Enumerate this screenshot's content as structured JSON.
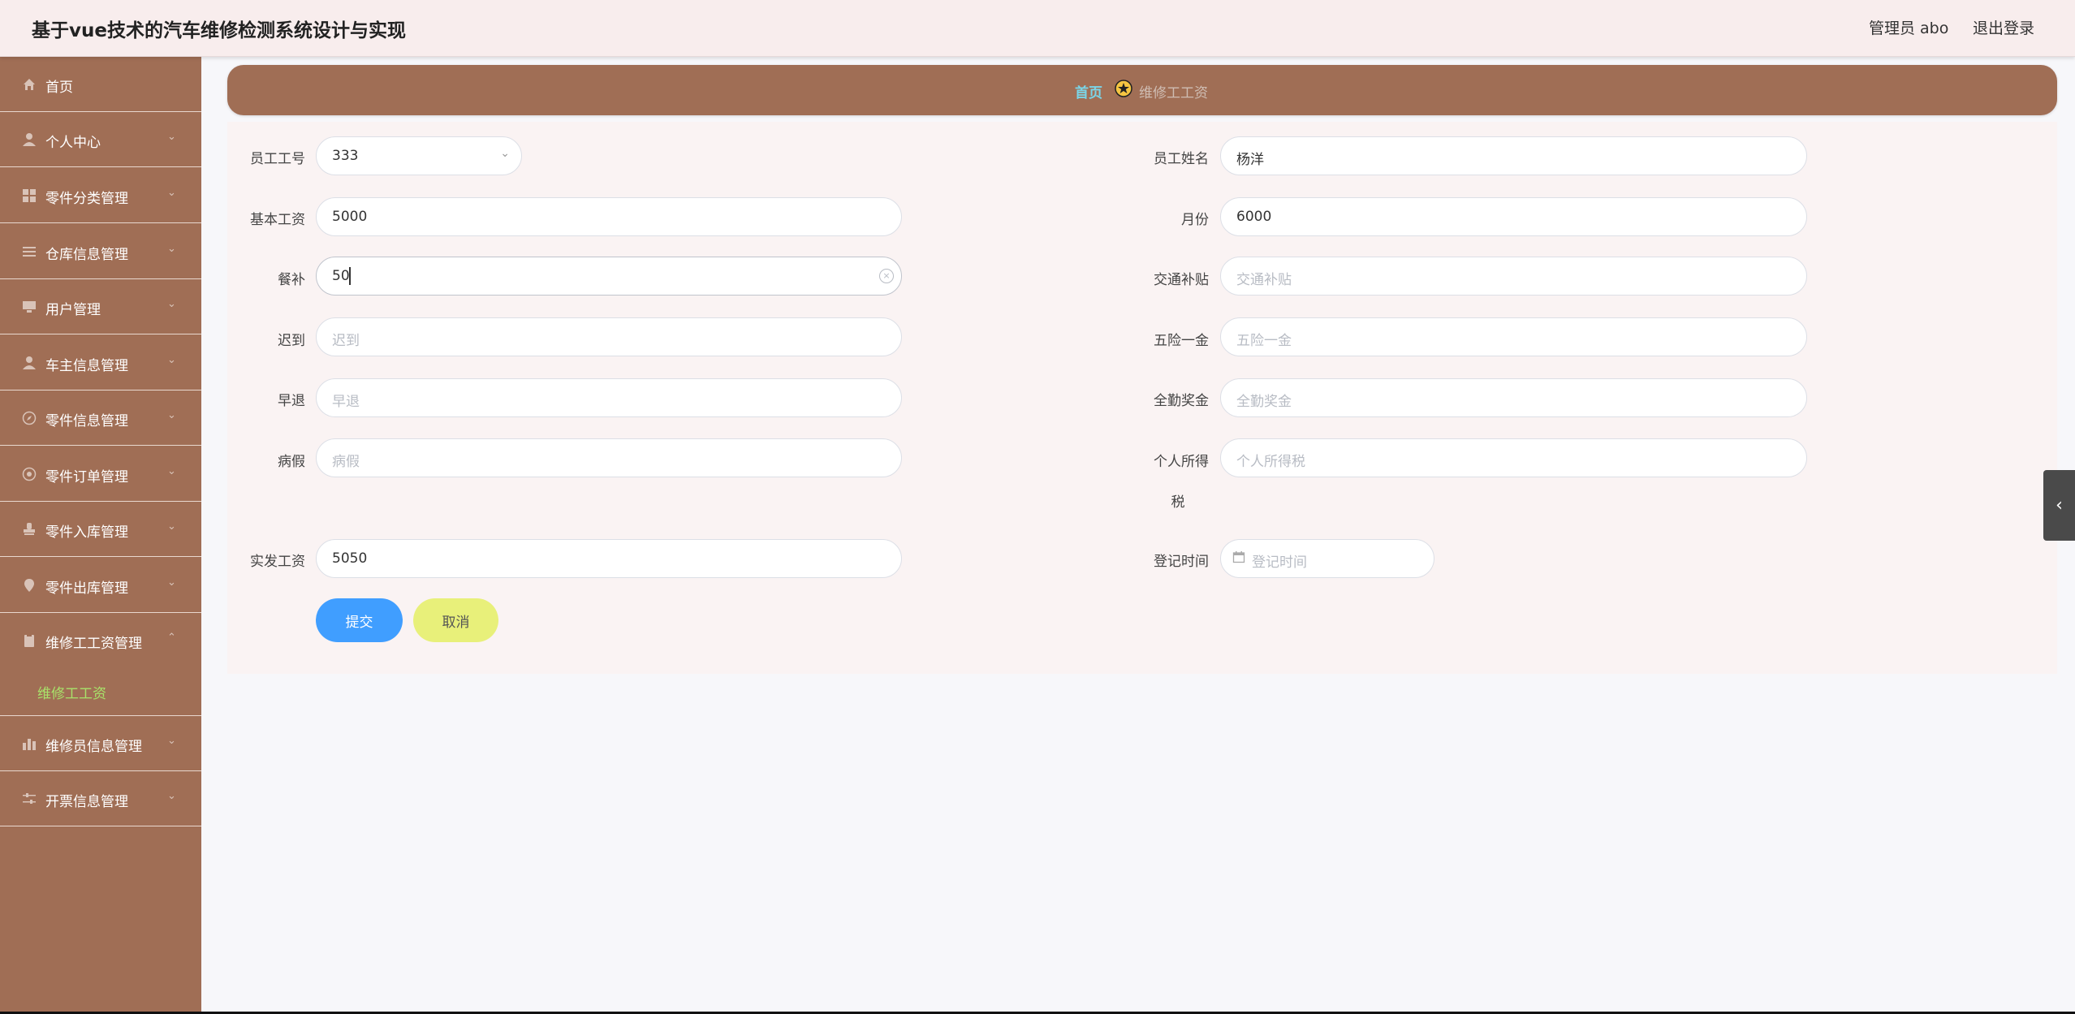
{
  "header": {
    "title": "基于vue技术的汽车维修检测系统设计与实现",
    "user": "管理员 abo",
    "logout": "退出登录"
  },
  "sidebar": {
    "items": [
      {
        "label": "首页",
        "icon": "home-icon"
      },
      {
        "label": "个人中心",
        "icon": "user-icon"
      },
      {
        "label": "零件分类管理",
        "icon": "grid-icon"
      },
      {
        "label": "仓库信息管理",
        "icon": "list-icon"
      },
      {
        "label": "用户管理",
        "icon": "monitor-icon"
      },
      {
        "label": "车主信息管理",
        "icon": "user-icon"
      },
      {
        "label": "零件信息管理",
        "icon": "compass-icon"
      },
      {
        "label": "零件订单管理",
        "icon": "settings-icon"
      },
      {
        "label": "零件入库管理",
        "icon": "stamp-icon"
      },
      {
        "label": "零件出库管理",
        "icon": "location-icon"
      },
      {
        "label": "维修工工资管理",
        "icon": "clipboard-icon"
      },
      {
        "label": "维修员信息管理",
        "icon": "chart-icon"
      },
      {
        "label": "开票信息管理",
        "icon": "sliders-icon"
      }
    ],
    "active_submenu": "维修工工资"
  },
  "breadcrumb": {
    "home": "首页",
    "current": "维修工工资"
  },
  "form": {
    "employee_no": {
      "label": "员工工号",
      "value": "333"
    },
    "employee_name": {
      "label": "员工姓名",
      "value": "杨洋"
    },
    "base_salary": {
      "label": "基本工资",
      "value": "5000"
    },
    "month": {
      "label": "月份",
      "value": "6000"
    },
    "meal_allowance": {
      "label": "餐补",
      "value": "50"
    },
    "transport_allowance": {
      "label": "交通补贴",
      "placeholder": "交通补贴"
    },
    "late": {
      "label": "迟到",
      "placeholder": "迟到"
    },
    "insurance": {
      "label": "五险一金",
      "placeholder": "五险一金"
    },
    "early_leave": {
      "label": "早退",
      "placeholder": "早退"
    },
    "attendance_bonus": {
      "label": "全勤奖金",
      "placeholder": "全勤奖金"
    },
    "sick_leave": {
      "label": "病假",
      "placeholder": "病假"
    },
    "income_tax": {
      "label_line1": "个人所得",
      "label_line2": "税",
      "placeholder": "个人所得税"
    },
    "net_salary": {
      "label": "实发工资",
      "value": "5050"
    },
    "register_time": {
      "label": "登记时间",
      "placeholder": "登记时间"
    },
    "submit": "提交",
    "cancel": "取消"
  },
  "colors": {
    "sidebar_bg": "#a06e55",
    "header_bg": "#f8eded",
    "submit_btn": "#409eff",
    "cancel_btn": "#e8f07a",
    "active_submenu": "#a8e26a"
  }
}
